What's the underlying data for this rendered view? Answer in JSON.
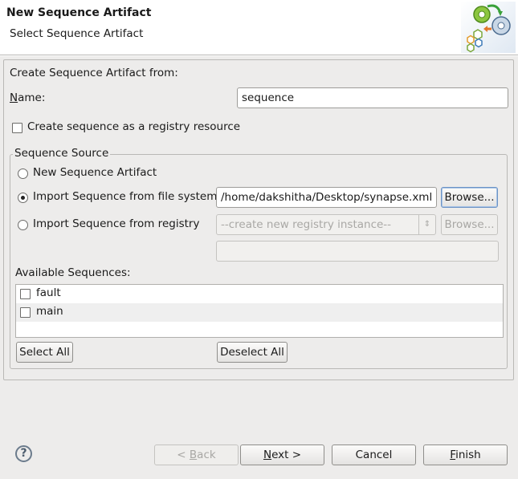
{
  "header": {
    "title": "New Sequence Artifact",
    "subtitle": "Select Sequence Artifact",
    "banner_icon": "sequence-wizard-icon"
  },
  "form": {
    "create_from_label": "Create Sequence Artifact from:",
    "name_label_mnemonic": "N",
    "name_label_rest": "ame:",
    "name_value": "sequence",
    "registry_checkbox_label": "Create sequence as a registry resource",
    "registry_checkbox_checked": false
  },
  "source": {
    "legend": "Sequence Source",
    "options": [
      {
        "label": "New Sequence Artifact",
        "selected": false
      },
      {
        "label": "Import Sequence from file system",
        "selected": true
      },
      {
        "label": "Import Sequence from registry",
        "selected": false
      }
    ],
    "file_path": "/home/dakshitha/Desktop/synapse.xml",
    "browse_label": "Browse...",
    "registry_combo_value": "--create new registry instance--",
    "registry_browse_label": "Browse...",
    "registry_path_value": ""
  },
  "sequences": {
    "label": "Available Sequences:",
    "items": [
      {
        "name": "fault",
        "checked": false
      },
      {
        "name": "main",
        "checked": false
      }
    ],
    "select_all": "Select All",
    "deselect_all": "Deselect All"
  },
  "footer": {
    "help_icon": "?",
    "back_prefix": "< ",
    "back_mnemonic": "B",
    "back_rest": "ack",
    "next_mnemonic": "N",
    "next_rest": "ext >",
    "cancel": "Cancel",
    "finish_mnemonic": "F",
    "finish_rest": "inish"
  },
  "colors": {
    "background": "#edeceb",
    "header_background": "#ffffff",
    "focus_border": "#6c93c5"
  }
}
